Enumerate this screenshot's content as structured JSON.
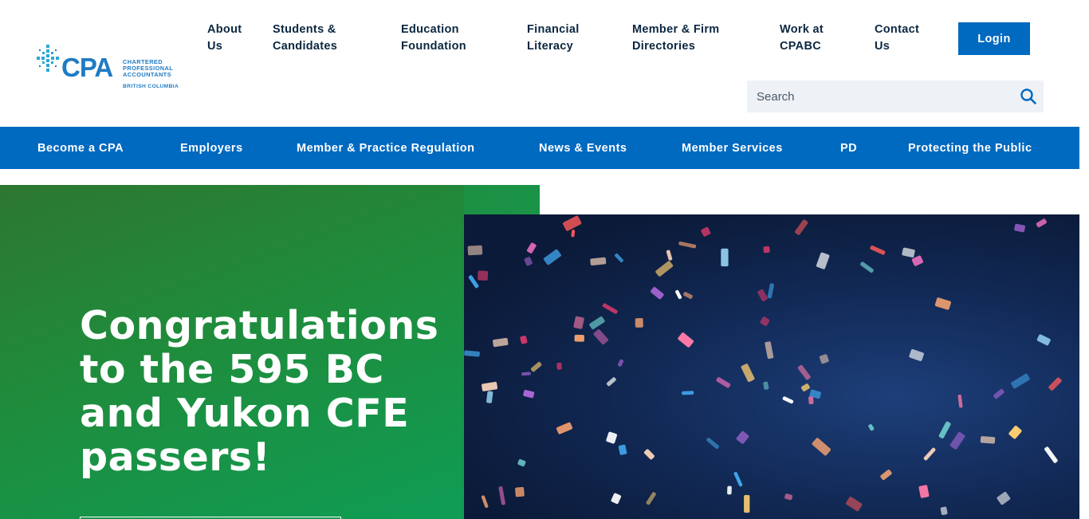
{
  "brand": {
    "logo_word": "CPA",
    "logo_sub_lines": [
      "CHARTERED",
      "PROFESSIONAL",
      "ACCOUNTANTS"
    ],
    "logo_region": "BRITISH COLUMBIA",
    "color_primary": "#0069c0",
    "color_logo": "#1f7bc4"
  },
  "topnav": {
    "items": [
      {
        "label_l1": "About",
        "label_l2": "Us"
      },
      {
        "label_l1": "Students &",
        "label_l2": "Candidates"
      },
      {
        "label_l1": "Education",
        "label_l2": "Foundation"
      },
      {
        "label_l1": "Financial",
        "label_l2": "Literacy"
      },
      {
        "label_l1": "Member & Firm",
        "label_l2": "Directories"
      },
      {
        "label_l1": "Work at",
        "label_l2": "CPABC"
      },
      {
        "label_l1": "Contact",
        "label_l2": "Us"
      }
    ],
    "login_label": "Login"
  },
  "search": {
    "placeholder": "Search",
    "icon": "search-icon"
  },
  "mainnav": {
    "items": [
      "Become a CPA",
      "Employers",
      "Member & Practice Regulation",
      "News & Events",
      "Member Services",
      "PD",
      "Protecting the Public"
    ]
  },
  "hero": {
    "title": "Congratulations to the 595 BC and Yukon CFE passers!",
    "image_subject": "confetti",
    "color_green": "#1f8c3c"
  }
}
